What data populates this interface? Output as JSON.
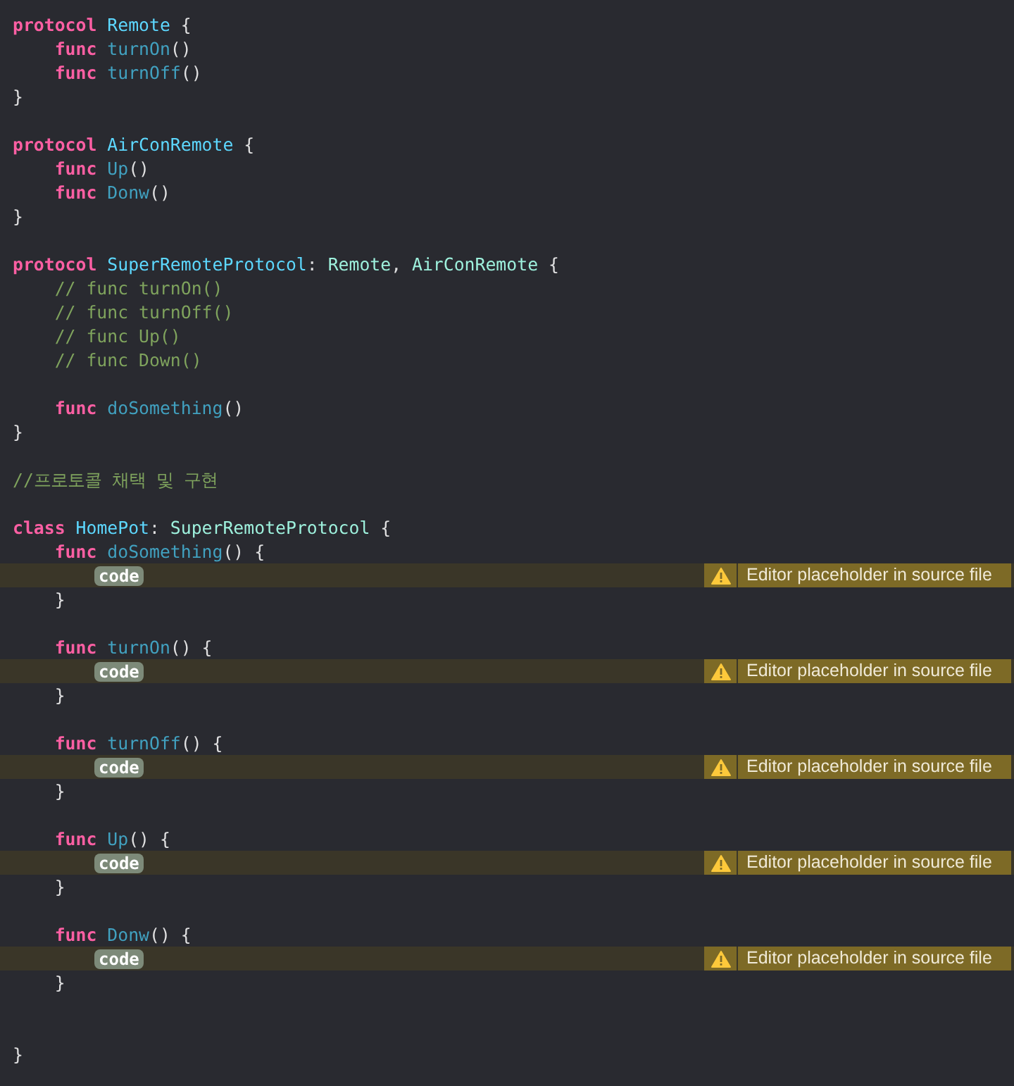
{
  "editor": {
    "lines": [
      {
        "kind": "code",
        "tokens": [
          {
            "kind": "keyword",
            "text": "protocol"
          },
          {
            "kind": "type_decl",
            "text": " Remote"
          },
          {
            "kind": "plain",
            "text": " {"
          }
        ]
      },
      {
        "kind": "code",
        "tokens": [
          {
            "kind": "keyword",
            "text": "    func"
          },
          {
            "kind": "func_decl",
            "text": " turnOn"
          },
          {
            "kind": "plain",
            "text": "()"
          }
        ]
      },
      {
        "kind": "code",
        "tokens": [
          {
            "kind": "keyword",
            "text": "    func"
          },
          {
            "kind": "func_decl",
            "text": " turnOff"
          },
          {
            "kind": "plain",
            "text": "()"
          }
        ]
      },
      {
        "kind": "code",
        "tokens": [
          {
            "kind": "plain",
            "text": "}"
          }
        ]
      },
      {
        "kind": "blank"
      },
      {
        "kind": "code",
        "tokens": [
          {
            "kind": "keyword",
            "text": "protocol"
          },
          {
            "kind": "type_decl",
            "text": " AirConRemote"
          },
          {
            "kind": "plain",
            "text": " {"
          }
        ]
      },
      {
        "kind": "code",
        "tokens": [
          {
            "kind": "keyword",
            "text": "    func"
          },
          {
            "kind": "func_decl",
            "text": " Up"
          },
          {
            "kind": "plain",
            "text": "()"
          }
        ]
      },
      {
        "kind": "code",
        "tokens": [
          {
            "kind": "keyword",
            "text": "    func"
          },
          {
            "kind": "func_decl",
            "text": " Donw"
          },
          {
            "kind": "plain",
            "text": "()"
          }
        ]
      },
      {
        "kind": "code",
        "tokens": [
          {
            "kind": "plain",
            "text": "}"
          }
        ]
      },
      {
        "kind": "blank"
      },
      {
        "kind": "code",
        "tokens": [
          {
            "kind": "keyword",
            "text": "protocol"
          },
          {
            "kind": "type_decl",
            "text": " SuperRemoteProtocol"
          },
          {
            "kind": "plain",
            "text": ":"
          },
          {
            "kind": "type_ref",
            "text": " Remote"
          },
          {
            "kind": "plain",
            "text": ","
          },
          {
            "kind": "type_ref",
            "text": " AirConRemote"
          },
          {
            "kind": "plain",
            "text": " {"
          }
        ]
      },
      {
        "kind": "code",
        "tokens": [
          {
            "kind": "comment",
            "text": "    // func turnOn()"
          }
        ]
      },
      {
        "kind": "code",
        "tokens": [
          {
            "kind": "comment",
            "text": "    // func turnOff()"
          }
        ]
      },
      {
        "kind": "code",
        "tokens": [
          {
            "kind": "comment",
            "text": "    // func Up()"
          }
        ]
      },
      {
        "kind": "code",
        "tokens": [
          {
            "kind": "comment",
            "text": "    // func Down()"
          }
        ]
      },
      {
        "kind": "blank"
      },
      {
        "kind": "code",
        "tokens": [
          {
            "kind": "keyword",
            "text": "    func"
          },
          {
            "kind": "func_decl",
            "text": " doSomething"
          },
          {
            "kind": "plain",
            "text": "()"
          }
        ]
      },
      {
        "kind": "code",
        "tokens": [
          {
            "kind": "plain",
            "text": "}"
          }
        ]
      },
      {
        "kind": "blank"
      },
      {
        "kind": "code",
        "tokens": [
          {
            "kind": "comment",
            "text": "//프로토콜 채택 및 구현"
          }
        ]
      },
      {
        "kind": "blank"
      },
      {
        "kind": "code",
        "tokens": [
          {
            "kind": "keyword",
            "text": "class"
          },
          {
            "kind": "type_decl",
            "text": " HomePot"
          },
          {
            "kind": "plain",
            "text": ":"
          },
          {
            "kind": "type_ref",
            "text": " SuperRemoteProtocol"
          },
          {
            "kind": "plain",
            "text": " {"
          }
        ]
      },
      {
        "kind": "code",
        "tokens": [
          {
            "kind": "keyword",
            "text": "    func"
          },
          {
            "kind": "func_decl",
            "text": " doSomething"
          },
          {
            "kind": "plain",
            "text": "() {"
          }
        ]
      },
      {
        "kind": "placeholder",
        "placeholder": "code",
        "issue": "Editor placeholder in source file"
      },
      {
        "kind": "code",
        "tokens": [
          {
            "kind": "plain",
            "text": "    }"
          }
        ]
      },
      {
        "kind": "blank"
      },
      {
        "kind": "code",
        "tokens": [
          {
            "kind": "keyword",
            "text": "    func"
          },
          {
            "kind": "func_decl",
            "text": " turnOn"
          },
          {
            "kind": "plain",
            "text": "() {"
          }
        ]
      },
      {
        "kind": "placeholder",
        "placeholder": "code",
        "issue": "Editor placeholder in source file"
      },
      {
        "kind": "code",
        "tokens": [
          {
            "kind": "plain",
            "text": "    }"
          }
        ]
      },
      {
        "kind": "blank"
      },
      {
        "kind": "code",
        "tokens": [
          {
            "kind": "keyword",
            "text": "    func"
          },
          {
            "kind": "func_decl",
            "text": " turnOff"
          },
          {
            "kind": "plain",
            "text": "() {"
          }
        ]
      },
      {
        "kind": "placeholder",
        "placeholder": "code",
        "issue": "Editor placeholder in source file"
      },
      {
        "kind": "code",
        "tokens": [
          {
            "kind": "plain",
            "text": "    }"
          }
        ]
      },
      {
        "kind": "blank"
      },
      {
        "kind": "code",
        "tokens": [
          {
            "kind": "keyword",
            "text": "    func"
          },
          {
            "kind": "func_decl",
            "text": " Up"
          },
          {
            "kind": "plain",
            "text": "() {"
          }
        ]
      },
      {
        "kind": "placeholder",
        "placeholder": "code",
        "issue": "Editor placeholder in source file"
      },
      {
        "kind": "code",
        "tokens": [
          {
            "kind": "plain",
            "text": "    }"
          }
        ]
      },
      {
        "kind": "blank"
      },
      {
        "kind": "code",
        "tokens": [
          {
            "kind": "keyword",
            "text": "    func"
          },
          {
            "kind": "func_decl",
            "text": " Donw"
          },
          {
            "kind": "plain",
            "text": "() {"
          }
        ]
      },
      {
        "kind": "placeholder",
        "placeholder": "code",
        "issue": "Editor placeholder in source file"
      },
      {
        "kind": "code",
        "tokens": [
          {
            "kind": "plain",
            "text": "    }"
          }
        ]
      },
      {
        "kind": "blank"
      },
      {
        "kind": "blank"
      },
      {
        "kind": "code",
        "tokens": [
          {
            "kind": "plain",
            "text": "}"
          }
        ]
      }
    ]
  }
}
